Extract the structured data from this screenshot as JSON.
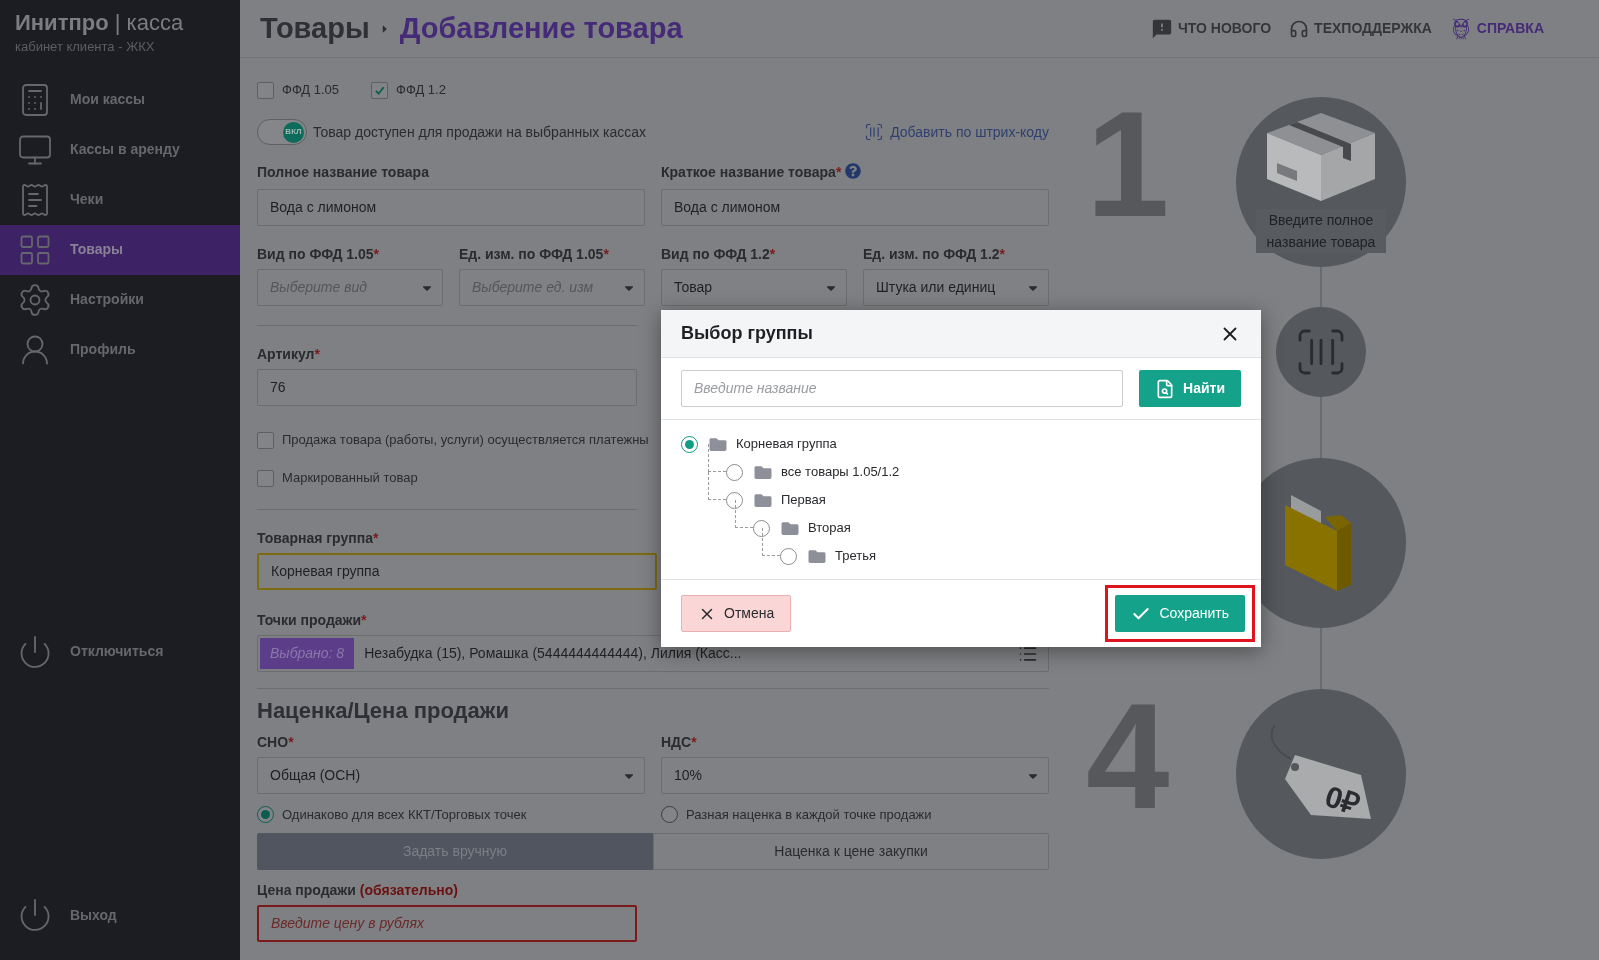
{
  "required_mark": "*",
  "sidebar": {
    "brand": "Инитпро",
    "separator": "|",
    "product": "касса",
    "subtitle": "кабинет клиента - ЖКХ",
    "items": [
      {
        "label": "Мои кассы",
        "kind": "register",
        "selected": false
      },
      {
        "label": "Кассы в аренду",
        "kind": "rent",
        "selected": false
      },
      {
        "label": "Чеки",
        "kind": "receipts",
        "selected": false
      },
      {
        "label": "Товары",
        "kind": "goods",
        "selected": true
      },
      {
        "label": "Настройки",
        "kind": "settings",
        "selected": false
      },
      {
        "label": "Профиль",
        "kind": "profile",
        "selected": false
      }
    ],
    "disconnect": "Отключиться",
    "logout": "Выход"
  },
  "header": {
    "breadcrumb": "Товары",
    "title": "Добавление товара",
    "links": [
      {
        "label": "ЧТО НОВОГО",
        "kind": "news"
      },
      {
        "label": "ТЕХПОДДЕРЖКА",
        "kind": "support"
      },
      {
        "label": "СПРАВКА",
        "kind": "help"
      }
    ]
  },
  "form": {
    "ffd": [
      {
        "label": "ФФД 1.05",
        "checked": false
      },
      {
        "label": "ФФД 1.2",
        "checked": true
      }
    ],
    "availability": {
      "badge": "ВКЛ",
      "label": "Товар доступен для продажи на выбранных кассах",
      "on": true
    },
    "barcode_link": "Добавить по штрих-коду",
    "full_name": {
      "label": "Полное название товара",
      "required": false,
      "value": "Вода с лимоном"
    },
    "short_name": {
      "label": "Краткое название товара",
      "required": true,
      "value": "Вода с лимоном"
    },
    "selects": [
      {
        "label": "Вид по ФФД 1.05",
        "required": true,
        "placeholder": "Выберите вид"
      },
      {
        "label": "Ед. изм. по ФФД 1.05",
        "required": true,
        "placeholder": "Выберите ед. изм"
      },
      {
        "label": "Вид по ФФД 1.2",
        "required": true,
        "value": "Товар"
      },
      {
        "label": "Ед. изм. по ФФД 1.2",
        "required": true,
        "value": "Штука или единиц"
      }
    ],
    "article": {
      "label": "Артикул",
      "required": true,
      "value": "76"
    },
    "flags": [
      {
        "label": "Продажа товара (работы, услуги) осуществляется платежны",
        "checked": false
      },
      {
        "label": "Маркированный товар",
        "checked": false
      }
    ],
    "group": {
      "label": "Товарная группа",
      "required": true,
      "value": "Корневая группа"
    },
    "points": {
      "label": "Точки продажи",
      "required": true,
      "badge": "Выбрано: 8",
      "value": "Незабудка (15), Ромашка (5444444444444), Лилия (Касс..."
    }
  },
  "pricing": {
    "heading": "Наценка/Цена продажи",
    "tax_system": {
      "label": "СНО",
      "required": true,
      "value": "Общая (ОСН)"
    },
    "vat": {
      "label": "НДС",
      "required": true,
      "value": "10%"
    },
    "modes": [
      {
        "label": "Одинаково для всех ККТ/Торговых точек",
        "selected": true
      },
      {
        "label": "Разная наценка в каждой точке продажи",
        "selected": false
      }
    ],
    "tabs": [
      {
        "label": "Задать вручную",
        "selected": true
      },
      {
        "label": "Наценка к цене закупки",
        "selected": false
      }
    ],
    "price": {
      "label": "Цена продажи",
      "note": "(обязательно)",
      "placeholder": "Введите цену в рублях"
    }
  },
  "steps": [
    {
      "number": "1",
      "kind": "box",
      "caption": "Введите полное название товара"
    },
    {
      "kind": "barcode"
    },
    {
      "kind": "folder"
    },
    {
      "number": "4",
      "kind": "price",
      "tag": "0₽"
    }
  ],
  "dialog": {
    "title": "Выбор группы",
    "search_placeholder": "Введите название",
    "search_button": "Найти",
    "tree": [
      {
        "label": "Корневая группа",
        "selected": true,
        "children": [
          {
            "label": "все товары 1.05/1.2",
            "selected": false
          },
          {
            "label": "Первая",
            "selected": false,
            "children": [
              {
                "label": "Вторая",
                "selected": false,
                "children": [
                  {
                    "label": "Третья",
                    "selected": false
                  }
                ]
              }
            ]
          }
        ]
      }
    ],
    "cancel": "Отмена",
    "save": "Сохранить",
    "save_highlighted": true
  }
}
